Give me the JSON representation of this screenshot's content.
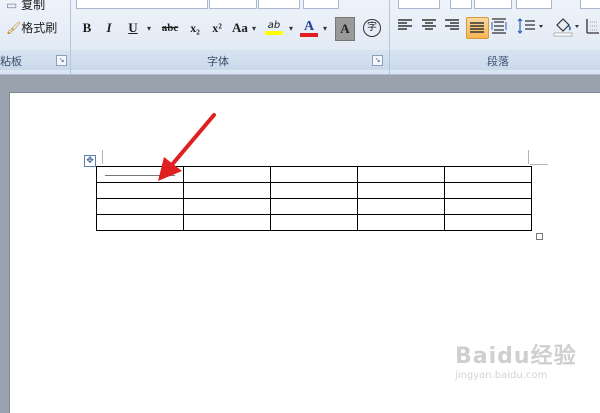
{
  "ribbon": {
    "clipboard": {
      "copy_label": "复制",
      "format_painter_label": "格式刷",
      "group_label": "粘板"
    },
    "font": {
      "group_label": "字体",
      "bold": "B",
      "italic": "I",
      "underline": "U",
      "strikethrough": "abc",
      "subscript": "x₂",
      "superscript": "x²",
      "change_case": "Aa",
      "highlight_color": "#ffff00",
      "font_color": "#e02020",
      "char_shading": "A",
      "enclose": "字"
    },
    "paragraph": {
      "group_label": "段落"
    }
  },
  "document": {
    "table": {
      "rows": 4,
      "cols": 5
    }
  },
  "annotation": {
    "arrow_color": "#e02020"
  },
  "watermark": {
    "brand": "Baidu经验",
    "url": "jingyan.baidu.com"
  }
}
